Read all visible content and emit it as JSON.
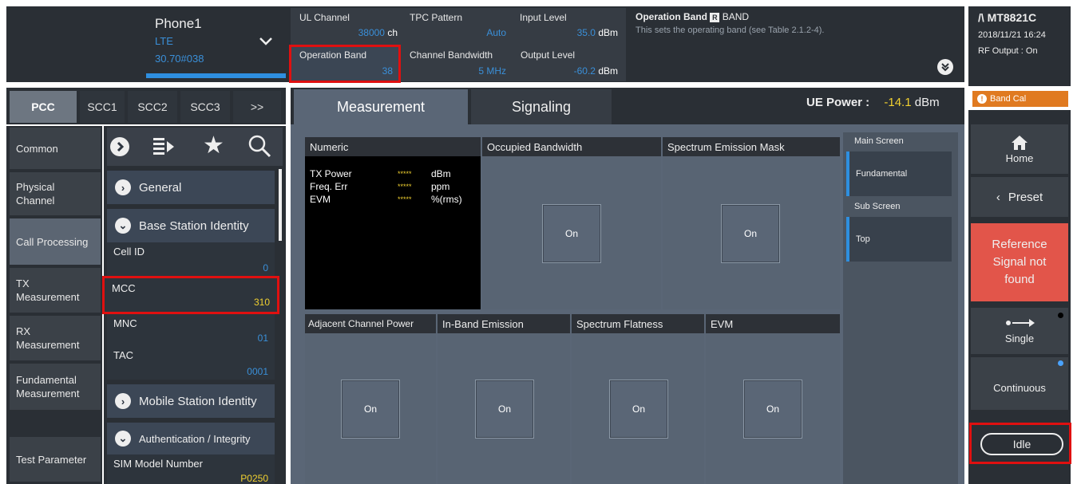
{
  "header": {
    "phone_title": "Phone1",
    "phone_rat": "LTE",
    "phone_id": "30.70#038",
    "chevron_icon": "chevron-down-icon"
  },
  "params": {
    "ul_channel": {
      "label": "UL Channel",
      "value": "38000",
      "unit": "ch"
    },
    "tpc_pattern": {
      "label": "TPC Pattern",
      "value": "Auto"
    },
    "input_level": {
      "label": "Input Level",
      "value": "35.0",
      "unit": "dBm"
    },
    "operation_band": {
      "label": "Operation Band",
      "value": "38"
    },
    "channel_bandwidth": {
      "label": "Channel Bandwidth",
      "value": "5 MHz"
    },
    "output_level": {
      "label": "Output Level",
      "value": "-60.2",
      "unit": "dBm"
    }
  },
  "help": {
    "title": "Operation Band",
    "title_suffix": "BAND",
    "text": "This sets the operating band (see Table 2.1.2-4)."
  },
  "device": {
    "model": "MT8821C",
    "datetime": "2018/11/21 16:24",
    "rf_output": "RF Output : On"
  },
  "cc_tabs": [
    "PCC",
    "SCC1",
    "SCC2",
    "SCC3",
    ">>"
  ],
  "main_tabs": {
    "measurement": "Measurement",
    "signaling": "Signaling"
  },
  "ue_power": {
    "label": "UE Power :",
    "value": "-14.1",
    "unit": "dBm"
  },
  "band_cal": "Band Cal",
  "left_nav": [
    "Common",
    "Physical Channel",
    "Call Processing",
    "TX Measurement",
    "RX Measurement",
    "Fundamental Measurement",
    "",
    "Test Parameter"
  ],
  "sections": {
    "general": "General",
    "base_station_identity": "Base Station Identity",
    "mobile_station_identity": "Mobile Station Identity",
    "auth": "Authentication / Integrity"
  },
  "fields": {
    "cell_id": {
      "label": "Cell ID",
      "value": "0"
    },
    "mcc": {
      "label": "MCC",
      "value": "310"
    },
    "mnc": {
      "label": "MNC",
      "value": "01"
    },
    "tac": {
      "label": "TAC",
      "value": "0001"
    },
    "sim_model": {
      "label": "SIM Model Number",
      "value": "P0250"
    }
  },
  "numeric": {
    "title": "Numeric",
    "rows": [
      {
        "label": "TX Power",
        "value": "*****",
        "unit": "dBm"
      },
      {
        "label": "Freq. Err",
        "value": "*****",
        "unit": "ppm"
      },
      {
        "label": "EVM",
        "value": "*****",
        "unit": "%(rms)"
      }
    ]
  },
  "panels": {
    "obw": "Occupied Bandwidth",
    "sem": "Spectrum Emission Mask",
    "acp": "Adjacent Channel Power",
    "ibe": "In-Band Emission",
    "sf": "Spectrum Flatness",
    "evm": "EVM",
    "on_label": "On"
  },
  "screens": {
    "main_label": "Main Screen",
    "main_value": "Fundamental",
    "sub_label": "Sub Screen",
    "sub_value": "Top"
  },
  "right": {
    "home": "Home",
    "preset": "Preset",
    "alert": "Reference Signal not found",
    "single": "Single",
    "continuous": "Continuous",
    "idle": "Idle"
  },
  "colors": {
    "accent_blue": "#3a8fd8",
    "alert_red": "#e2554a",
    "bandcal_orange": "#e07a20",
    "ue_power_yellow": "#f0d030"
  }
}
